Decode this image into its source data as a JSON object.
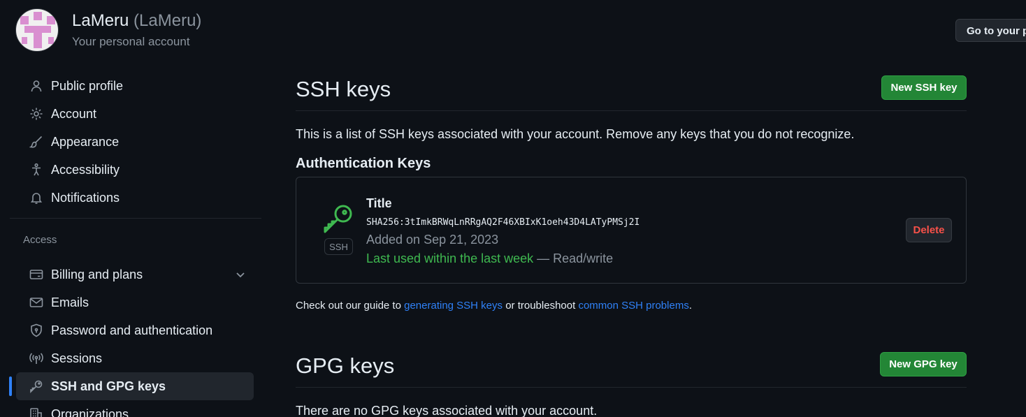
{
  "header": {
    "display_name": "LaMeru",
    "login": "(LaMeru)",
    "subtitle": "Your personal account",
    "goto_button": "Go to your personal profile"
  },
  "sidebar": {
    "items_top": [
      {
        "label": "Public profile",
        "icon": "person-icon"
      },
      {
        "label": "Account",
        "icon": "gear-icon"
      },
      {
        "label": "Appearance",
        "icon": "paintbrush-icon"
      },
      {
        "label": "Accessibility",
        "icon": "accessibility-icon"
      },
      {
        "label": "Notifications",
        "icon": "bell-icon"
      }
    ],
    "access_label": "Access",
    "items_access": [
      {
        "label": "Billing and plans",
        "icon": "credit-card-icon"
      },
      {
        "label": "Emails",
        "icon": "mail-icon"
      },
      {
        "label": "Password and authentication",
        "icon": "shield-lock-icon"
      },
      {
        "label": "Sessions",
        "icon": "broadcast-icon"
      },
      {
        "label": "SSH and GPG keys",
        "icon": "key-icon",
        "active": true
      },
      {
        "label": "Organizations",
        "icon": "organization-icon"
      }
    ]
  },
  "ssh": {
    "heading": "SSH keys",
    "new_button": "New SSH key",
    "description": "This is a list of SSH keys associated with your account. Remove any keys that you do not recognize.",
    "auth_heading": "Authentication Keys",
    "key": {
      "badge": "SSH",
      "title": "Title",
      "fingerprint": "SHA256:3tImkBRWqLnRRgAQ2F46XBIxK1oeh43D4LATyPMSj2I",
      "added": "Added on Sep 21, 2023",
      "last_used": "Last used within the last week",
      "access": " — Read/write",
      "delete_button": "Delete"
    },
    "guide": {
      "prefix": "Check out our guide to ",
      "link1": "generating SSH keys",
      "middle": " or troubleshoot ",
      "link2": "common SSH problems",
      "suffix": "."
    }
  },
  "gpg": {
    "heading": "GPG keys",
    "new_button": "New GPG key",
    "description": "There are no GPG keys associated with your account."
  },
  "colors": {
    "background": "#0d1117",
    "accent_blue": "#2f81f7",
    "button_green": "#238636",
    "danger_red": "#f85149",
    "success_green": "#3fb950"
  }
}
